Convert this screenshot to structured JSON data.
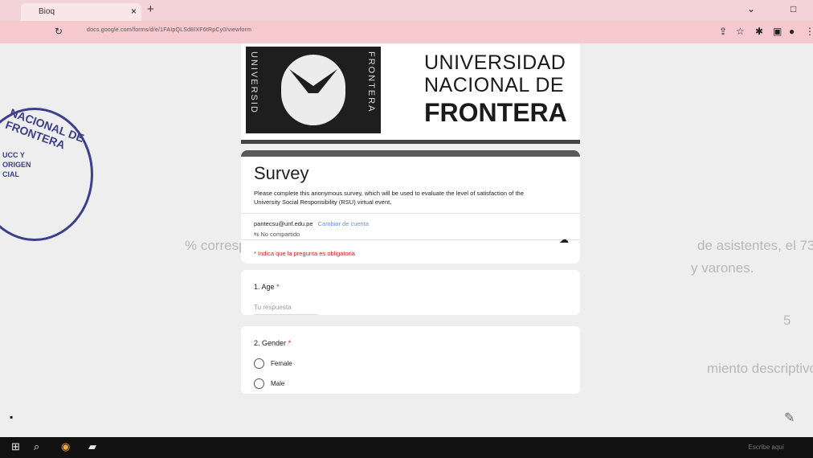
{
  "browser": {
    "tab_title": "Bioq",
    "url": "docs.google.com/forms/d/e/1FAIpQLSd8IXF6tRpCy0/viewform",
    "new_tab": "+",
    "close_tab": "×"
  },
  "background_text": {
    "line1": "de asistentes, el 73",
    "line1b": "% correspondía a",
    "line2": "y varones.",
    "line3": "5",
    "line4": "miento descriptivos"
  },
  "seal": {
    "upper_stamp": "FRONTERA",
    "left_stamp": "NACIONAL DE FRONTERA",
    "left_inner": "UCC Y ORIGEN CIAL"
  },
  "banner": {
    "side_left": "UNIVERSID",
    "side_right": "FRONTERA",
    "line1": "UNIVERSIDAD",
    "line2": "NACIONAL DE",
    "line3": "FRONTERA"
  },
  "form": {
    "title": "Survey",
    "description": "Please complete this anonymous survey, which will be used to evaluate the level of satisfaction of the University Social Responsibility (RSU) virtual event.",
    "account_email": "pantecsu@unf.edu.pe",
    "switch_account": "Cambiar de cuenta",
    "not_shared": "No compartido",
    "required_note": "* Indica que la pregunta es obligatoria",
    "questions": [
      {
        "number": "1.",
        "label": "Age",
        "required": "*",
        "placeholder": "Tu respuesta"
      },
      {
        "number": "2.",
        "label": "Gender",
        "required": "*",
        "options": [
          "Female",
          "Male"
        ]
      }
    ]
  },
  "taskbar": {
    "tray_text": "Escribe aquí"
  }
}
